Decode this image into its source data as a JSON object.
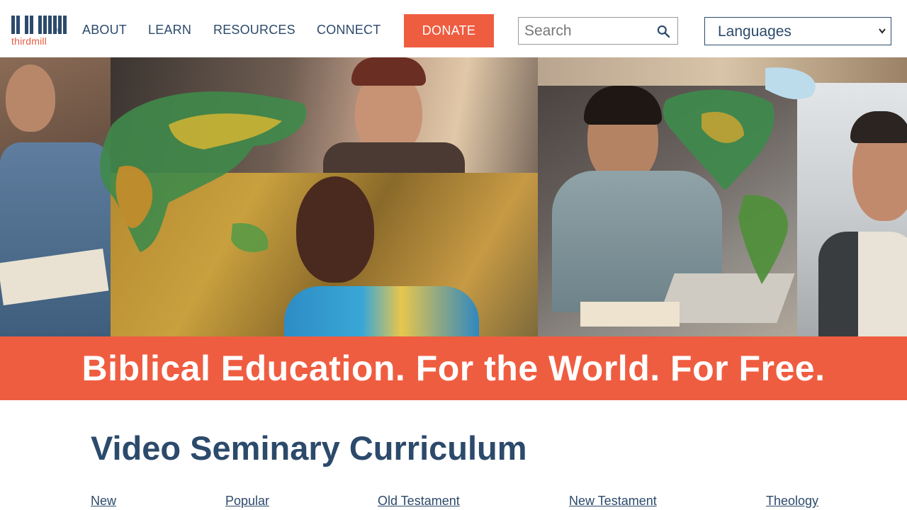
{
  "brand": {
    "logo_text": "thirdmill",
    "logo_mark": "IIIM"
  },
  "nav": {
    "items": [
      {
        "label": "ABOUT"
      },
      {
        "label": "LEARN"
      },
      {
        "label": "RESOURCES"
      },
      {
        "label": "CONNECT"
      }
    ],
    "donate_label": "DONATE"
  },
  "search": {
    "placeholder": "Search",
    "icon": "search-icon"
  },
  "languages": {
    "selected": "Languages",
    "icon": "chevron-down-icon"
  },
  "hero": {
    "banner_text": "Biblical Education. For the World. For Free."
  },
  "curriculum": {
    "title": "Video Seminary Curriculum",
    "tabs": [
      {
        "label": "New"
      },
      {
        "label": "Popular"
      },
      {
        "label": "Old Testament"
      },
      {
        "label": "New Testament"
      },
      {
        "label": "Theology"
      }
    ]
  },
  "colors": {
    "primary": "#2c4a6b",
    "accent": "#ef5d41"
  }
}
